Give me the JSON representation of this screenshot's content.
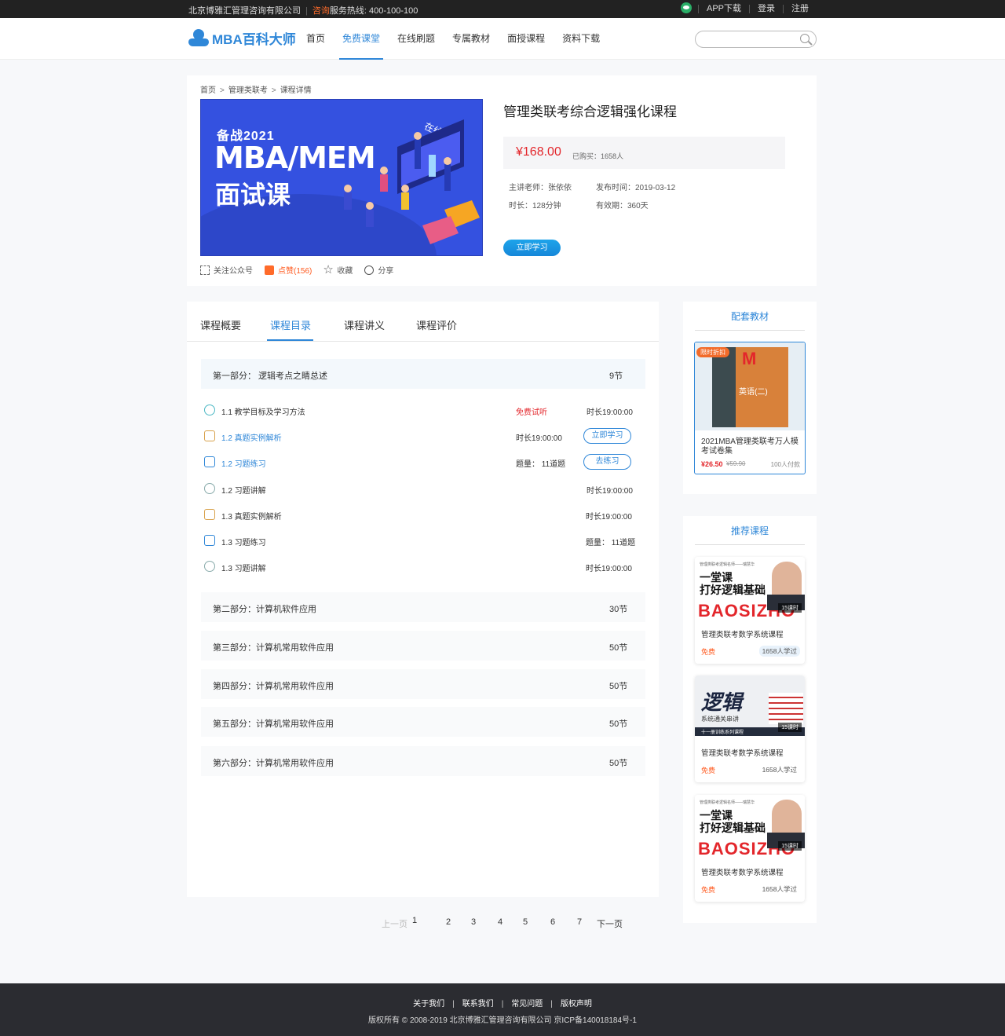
{
  "topbar": {
    "company": "北京博雅汇管理咨询有限公司",
    "consult": "咨询",
    "hotline_label": "服务热线:",
    "hotline": "400-100-100",
    "app_download": "APP下载",
    "login": "登录",
    "register": "注册"
  },
  "header": {
    "logo": "MBA百科大师",
    "nav": [
      "首页",
      "免费课堂",
      "在线刷题",
      "专属教材",
      "面授课程",
      "资料下载"
    ],
    "search_placeholder": ""
  },
  "breadcrumb": [
    "首页",
    "管理类联考",
    "课程详情"
  ],
  "banner": {
    "year": "备战2021",
    "title": "MBA/MEM",
    "subtitle": "面试课",
    "edu": "在线教育"
  },
  "course": {
    "title": "管理类联考综合逻辑强化课程",
    "price": "¥168.00",
    "sold": "已购买：1658人",
    "teacher": "主讲老师：张依依",
    "publish": "发布时间：2019-03-12",
    "duration": "时长：128分钟",
    "validity": "有效期：360天",
    "study_btn": "立即学习"
  },
  "actions": {
    "follow": "关注公众号",
    "like": "点赞(156)",
    "favorite": "收藏",
    "share": "分享"
  },
  "tabs": [
    "课程概要",
    "课程目录",
    "课程讲义",
    "课程评价"
  ],
  "sections": [
    {
      "title": "第一部分：  逻辑考点之睛总述",
      "count": "9节"
    },
    {
      "title": "第二部分：计算机软件应用",
      "count": "30节"
    },
    {
      "title": "第三部分：计算机常用软件应用",
      "count": "50节"
    },
    {
      "title": "第四部分：计算机常用软件应用",
      "count": "50节"
    },
    {
      "title": "第五部分：计算机常用软件应用",
      "count": "50节"
    },
    {
      "title": "第六部分：计算机常用软件应用",
      "count": "50节"
    }
  ],
  "lessons": [
    {
      "name": "1.1 教学目标及学习方法",
      "free": "免费试听",
      "meta": "时长19:00:00",
      "btn": ""
    },
    {
      "name": "1.2 真题实例解析",
      "free": "",
      "meta": "时长19:00:00",
      "btn": "立即学习"
    },
    {
      "name": "1.2 习题练习",
      "free": "",
      "meta": "题量：  11道题",
      "btn": "去练习"
    },
    {
      "name": "1.2 习题讲解",
      "free": "",
      "meta": "时长19:00:00",
      "btn": ""
    },
    {
      "name": "1.3 真题实例解析",
      "free": "",
      "meta": "时长19:00:00",
      "btn": ""
    },
    {
      "name": "1.3 习题练习",
      "free": "",
      "meta": "题量：  11道题",
      "btn": ""
    },
    {
      "name": "1.3 习题讲解",
      "free": "",
      "meta": "时长19:00:00",
      "btn": ""
    }
  ],
  "pager": {
    "prev": "上一页",
    "pages": [
      "1",
      "2",
      "3",
      "4",
      "5",
      "6",
      "7"
    ],
    "next": "下一页"
  },
  "material": {
    "title": "配套教材",
    "tag": "限时折扣",
    "book_title": "MBA MEM MPACC",
    "book_sub": "英语(二)",
    "name": "2021MBA管理类联考万人模考试卷集",
    "price": "¥26.50",
    "old_price": "¥59.90",
    "buyers": "100人付款"
  },
  "recommend": {
    "title": "推荐课程",
    "items": [
      {
        "small": "管理类联考逻辑名师——瑞慧华",
        "h1": "一堂课\n打好逻辑基础",
        "big": "BAOSIZHO",
        "hours": "15课时",
        "name": "管理类联考数学系统课程",
        "free": "免费",
        "count": "1658人学过"
      },
      {
        "logic": "逻辑",
        "logic_sub": "系统通关串讲",
        "bar": "十一册训练系列课程",
        "hours": "15课时",
        "name": "管理类联考数学系统课程",
        "free": "免费",
        "count": "1658人学过"
      },
      {
        "small": "管理类联考逻辑名师——瑞慧华",
        "h1": "一堂课\n打好逻辑基础",
        "big": "BAOSIZHO",
        "hours": "15课时",
        "name": "管理类联考数学系统课程",
        "free": "免费",
        "count": "1658人学过"
      }
    ]
  },
  "footer": {
    "links": [
      "关于我们",
      "联系我们",
      "常见问题",
      "版权声明"
    ],
    "copyright": "版权所有 © 2008-2019 北京博雅汇管理咨询有限公司 京ICP备140018184号-1"
  },
  "colors": {
    "accent": "#2f87d8",
    "price": "#e3262b",
    "orange": "#ff5a1f",
    "footer_bg": "#2b2c31"
  }
}
